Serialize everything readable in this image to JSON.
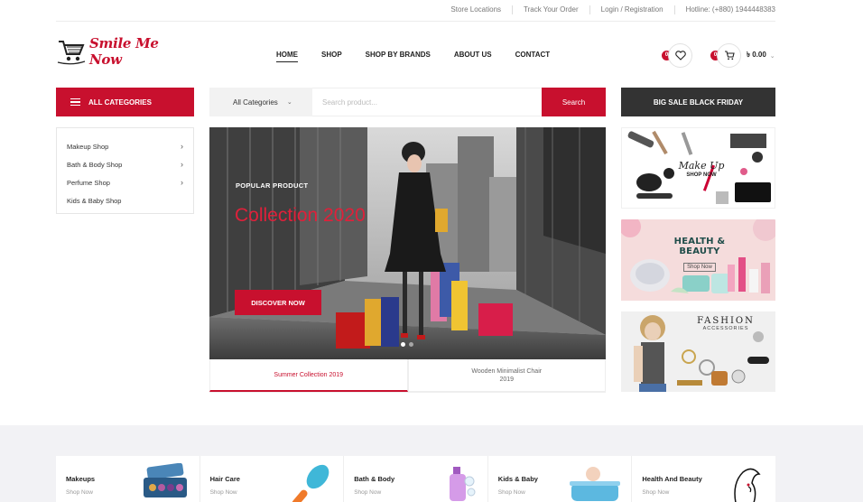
{
  "topbar": {
    "links": [
      "Store Locations",
      "Track Your Order",
      "Login / Registration",
      "Hotline: (+880) 1944448383"
    ]
  },
  "brand": {
    "name": "Smile Me Now",
    "accent": "#c8102e"
  },
  "nav": {
    "items": [
      "HOME",
      "SHOP",
      "SHOP BY BRANDS",
      "ABOUT US",
      "CONTACT"
    ],
    "active": "HOME"
  },
  "header": {
    "wishlist_count": "0",
    "cart_count": "0",
    "cart_total": "৳ 0.00"
  },
  "categories": {
    "button_label": "ALL CATEGORIES",
    "items": [
      {
        "label": "Makeup Shop",
        "has_sub": true
      },
      {
        "label": "Bath & Body Shop",
        "has_sub": true
      },
      {
        "label": "Perfume Shop",
        "has_sub": true
      },
      {
        "label": "Kids & Baby Shop",
        "has_sub": false
      }
    ]
  },
  "search": {
    "category": "All Categories",
    "placeholder": "Search product...",
    "button": "Search"
  },
  "promo": {
    "big_sale": "BIG SALE BLACK FRIDAY"
  },
  "hero": {
    "label": "POPULAR PRODUCT",
    "title": "Collection 2020",
    "button": "DISCOVER NOW",
    "slide_index": 1,
    "slide_count": 2,
    "tabs": [
      "Summer Collection 2019",
      "Wooden Minimalist Chair\n2019"
    ],
    "active_tab": 0
  },
  "banners": {
    "makeup": {
      "title": "Make Up",
      "cta": "SHOP NOW"
    },
    "health": {
      "title": "HEALTH & BEAUTY",
      "cta": "Shop Now"
    },
    "fashion": {
      "title": "FASHION",
      "subtitle": "ACCESSORIES"
    }
  },
  "bottom_cards": [
    {
      "title": "Makeups",
      "cta": "Shop Now",
      "icon": "makeup-palette-icon"
    },
    {
      "title": "Hair Care",
      "cta": "Shop Now",
      "icon": "hair-brush-icon"
    },
    {
      "title": "Bath & Body",
      "cta": "Shop Now",
      "icon": "soap-bottle-icon"
    },
    {
      "title": "Kids & Baby",
      "cta": "Shop Now",
      "icon": "baby-bath-icon"
    },
    {
      "title": "Health And Beauty",
      "cta": "Shop Now",
      "icon": "woman-face-icon"
    }
  ]
}
